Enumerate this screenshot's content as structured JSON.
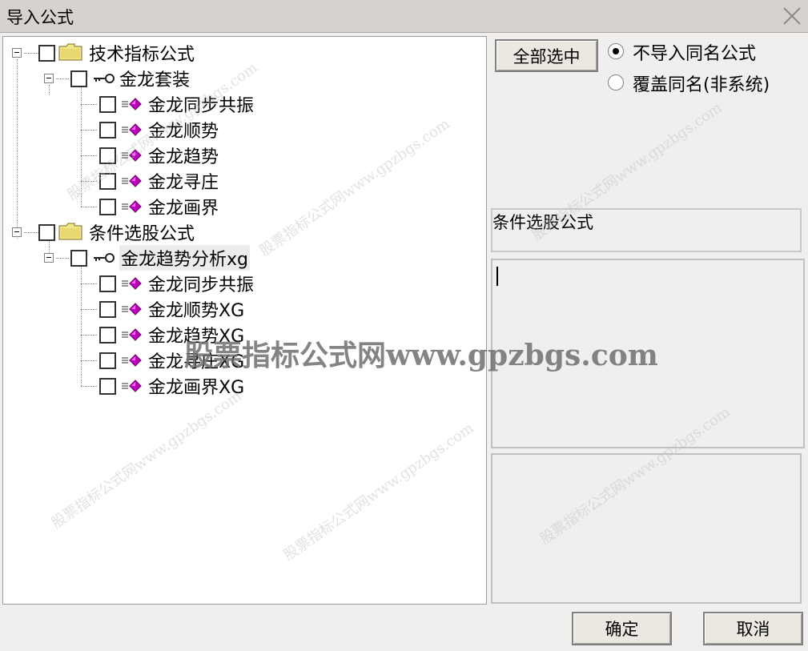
{
  "window": {
    "title": "导入公式"
  },
  "tree": {
    "groups": [
      {
        "label": "技术指标公式",
        "sets": [
          {
            "label": "金龙套装",
            "items": [
              "金龙同步共振",
              "金龙顺势",
              "金龙趋势",
              "金龙寻庄",
              "金龙画界"
            ]
          }
        ]
      },
      {
        "label": "条件选股公式",
        "sets": [
          {
            "label": "金龙趋势分析xg",
            "items": [
              "金龙同步共振",
              "金龙顺势XG",
              "金龙趋势XG",
              "金龙寻庄XG",
              "金龙画界XG"
            ]
          }
        ]
      }
    ]
  },
  "options": {
    "select_all_label": "全部选中",
    "radio_no_import_same": "不导入同名公式",
    "radio_overwrite_same": "覆盖同名(非系统)",
    "selected_radio": "no_import_same"
  },
  "info": {
    "category_text": "条件选股公式",
    "description_text": ""
  },
  "footer": {
    "ok_label": "确定",
    "cancel_label": "取消"
  },
  "watermark": {
    "text": "股票指标公式网www.gpzbgs.com"
  },
  "colors": {
    "folder": "#e8d870",
    "gem": "#c000c0",
    "titlebar": "#d6d3ce",
    "dialog_bg": "#f0efed"
  }
}
